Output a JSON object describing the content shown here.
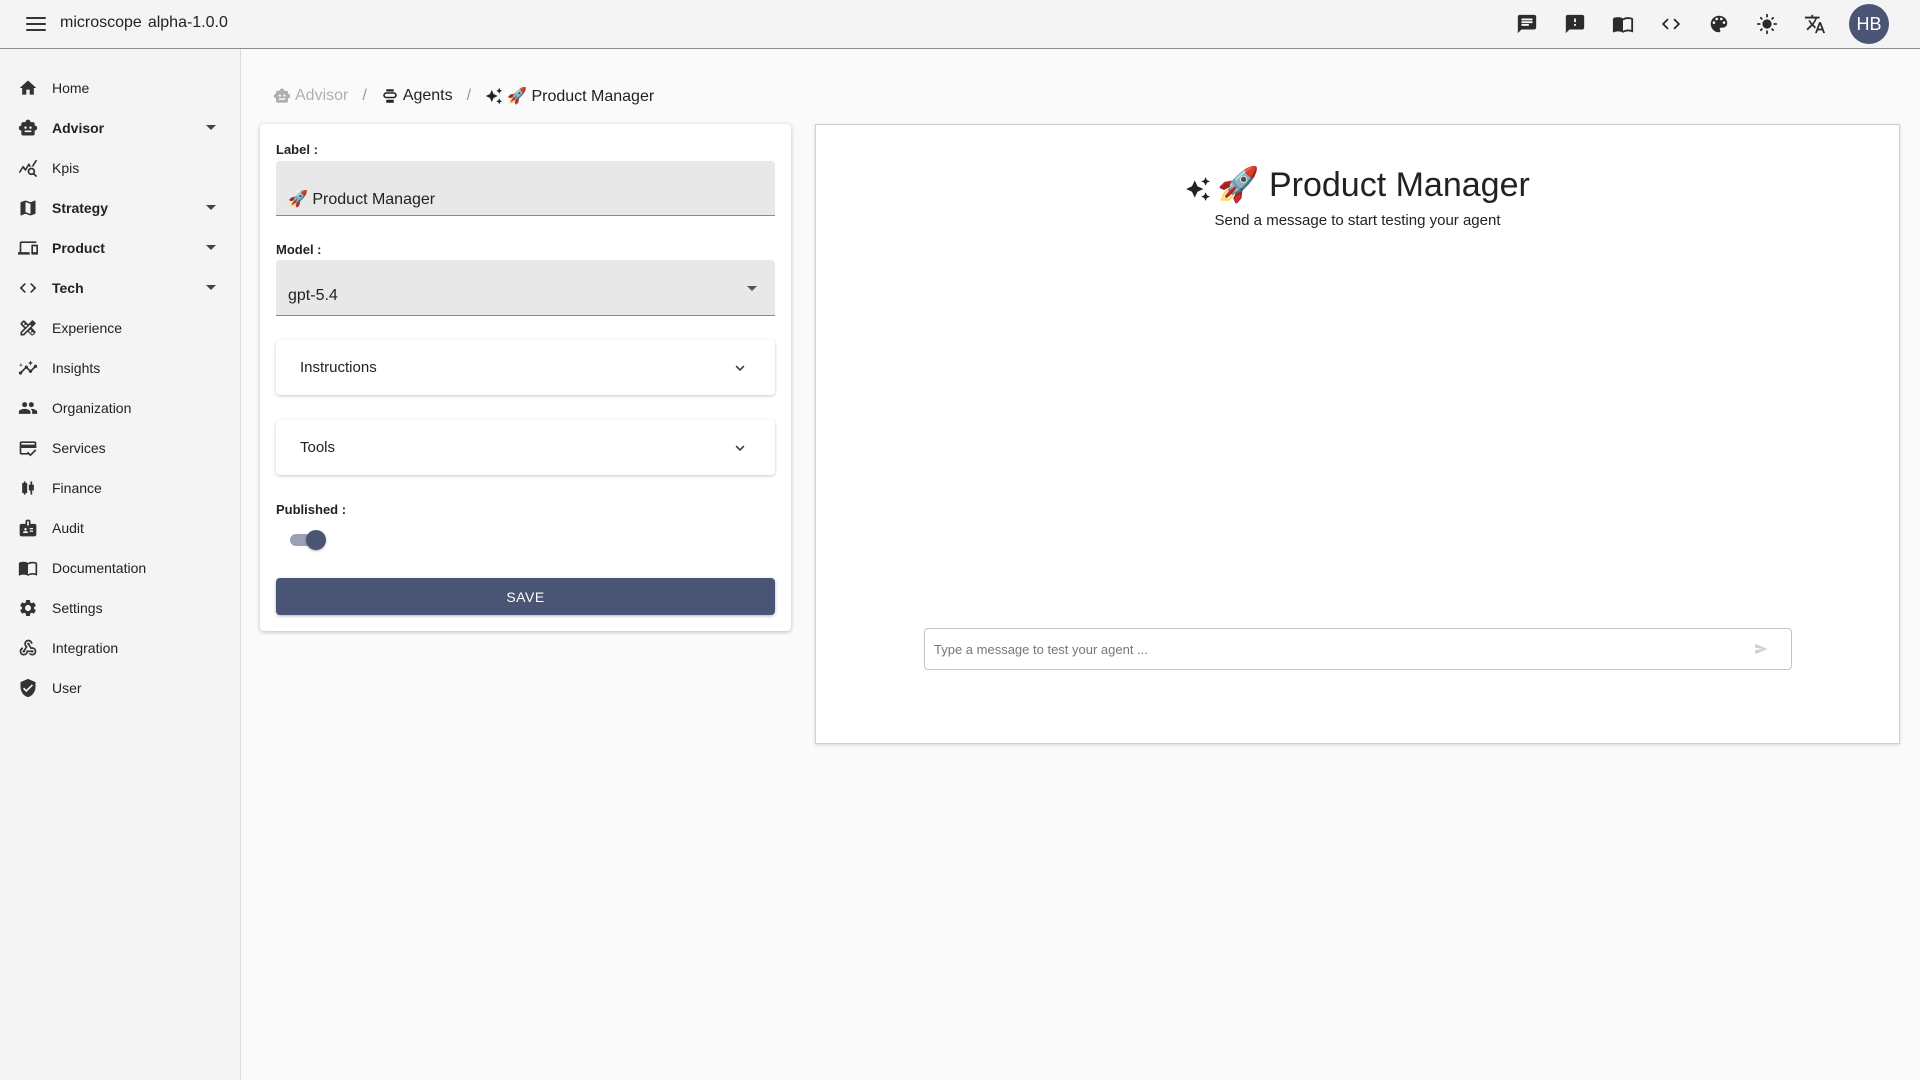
{
  "app": {
    "name": "microscope",
    "version": "alpha-1.0.0",
    "avatar_initials": "HB"
  },
  "topbar_icons": [
    "chat-icon",
    "feedback-icon",
    "book-icon",
    "code-icon",
    "palette-icon",
    "light-mode-icon",
    "translate-icon"
  ],
  "sidebar": {
    "items": [
      {
        "label": "Home",
        "icon": "home-icon",
        "expandable": false
      },
      {
        "label": "Advisor",
        "icon": "robot-icon",
        "expandable": true
      },
      {
        "label": "Kpis",
        "icon": "query-stats-icon",
        "expandable": false
      },
      {
        "label": "Strategy",
        "icon": "map-icon",
        "expandable": true
      },
      {
        "label": "Product",
        "icon": "devices-icon",
        "expandable": true
      },
      {
        "label": "Tech",
        "icon": "code-icon",
        "expandable": true
      },
      {
        "label": "Experience",
        "icon": "design-tools-icon",
        "expandable": false
      },
      {
        "label": "Insights",
        "icon": "insights-icon",
        "expandable": false
      },
      {
        "label": "Organization",
        "icon": "people-icon",
        "expandable": false
      },
      {
        "label": "Services",
        "icon": "services-icon",
        "expandable": false
      },
      {
        "label": "Finance",
        "icon": "candlestick-icon",
        "expandable": false
      },
      {
        "label": "Audit",
        "icon": "audit-icon",
        "expandable": false
      },
      {
        "label": "Documentation",
        "icon": "book-icon",
        "expandable": false
      },
      {
        "label": "Settings",
        "icon": "gear-icon",
        "expandable": false
      },
      {
        "label": "Integration",
        "icon": "webhook-icon",
        "expandable": false
      },
      {
        "label": "User",
        "icon": "shield-icon",
        "expandable": false
      }
    ]
  },
  "breadcrumb": {
    "advisor": "Advisor",
    "agents": "Agents",
    "current": "🚀 Product Manager",
    "separator": "/"
  },
  "form": {
    "label_label": "Label :",
    "label_value": "🚀 Product Manager",
    "model_label": "Model :",
    "model_value": "gpt-5.4",
    "instructions_label": "Instructions",
    "tools_label": "Tools",
    "published_label": "Published :",
    "published": true,
    "save_label": "SAVE"
  },
  "chat": {
    "title": "🚀 Product Manager",
    "subtitle": "Send a message to start testing your agent",
    "input_placeholder": "Type a message to test your agent ..."
  },
  "colors": {
    "primary": "#4a5575",
    "sidebar_bg": "#f4f4f4",
    "page_bg": "#fafafa"
  }
}
